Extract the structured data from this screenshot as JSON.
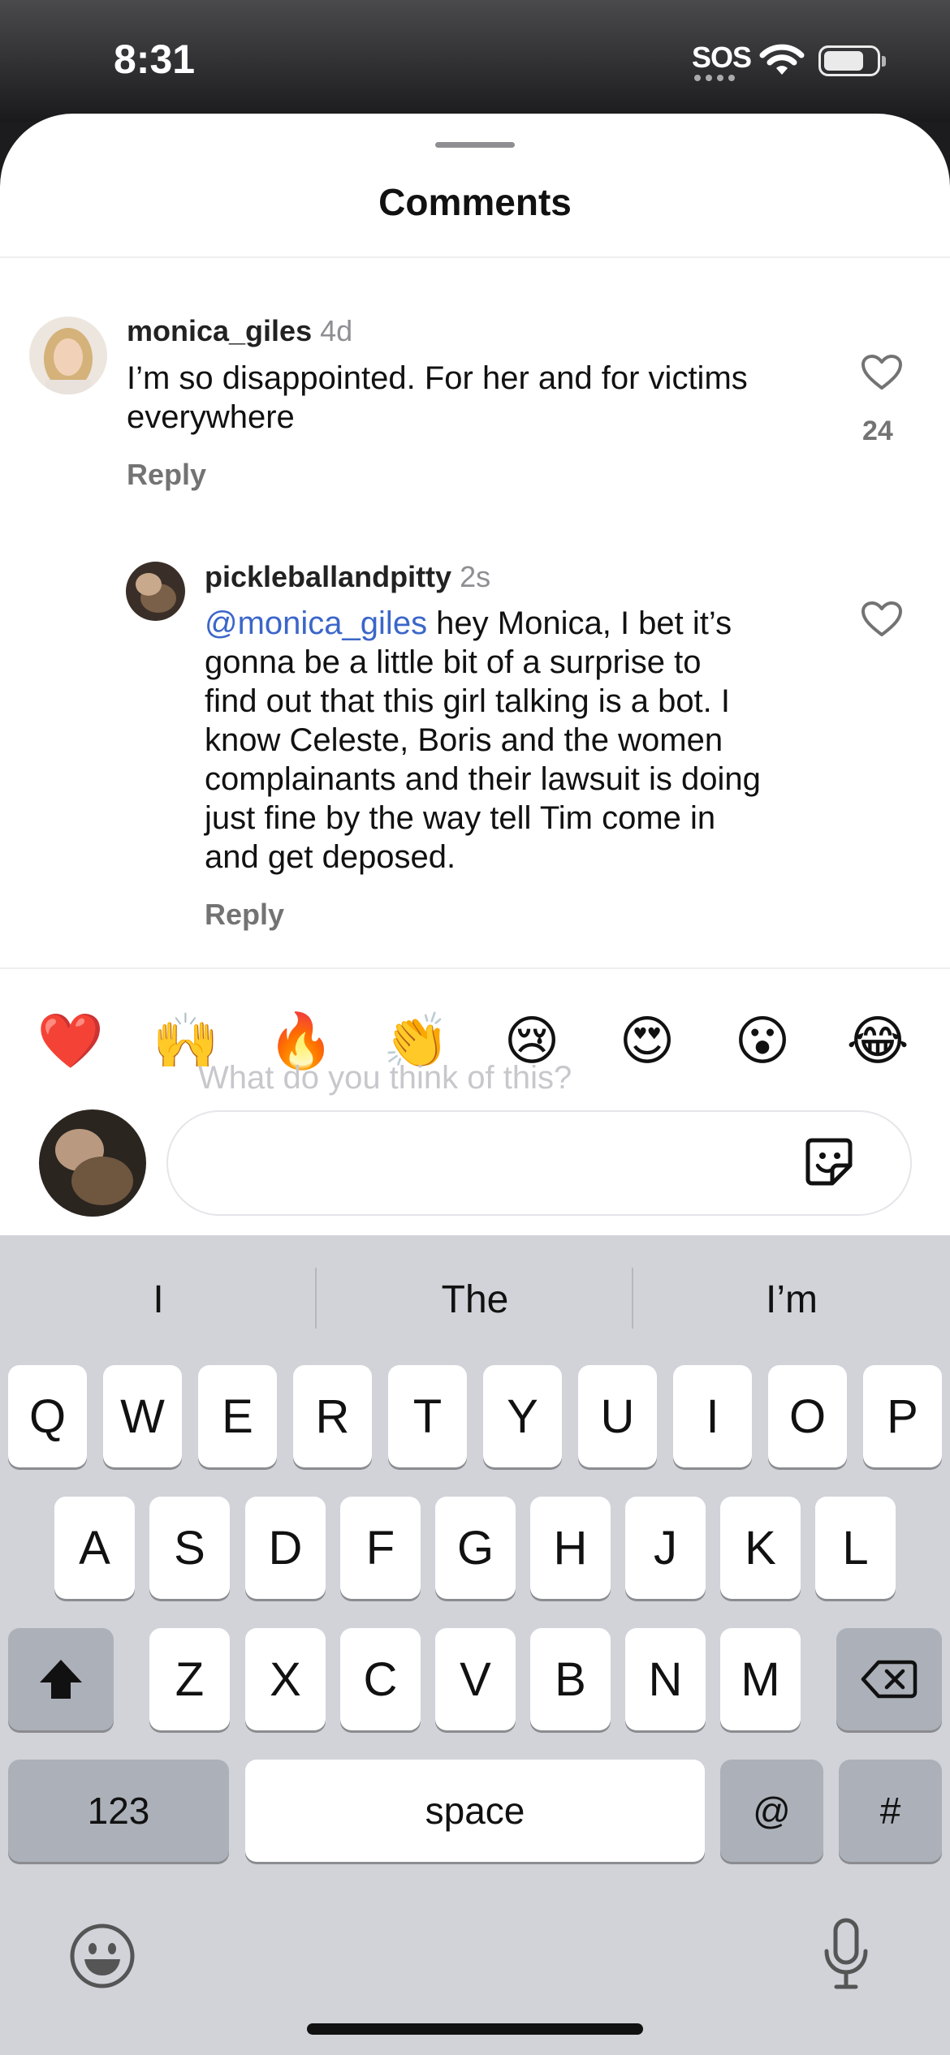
{
  "status": {
    "time": "8:31",
    "carrier": "SOS"
  },
  "sheet": {
    "title": "Comments"
  },
  "comments": [
    {
      "username": "monica_giles",
      "time": "4d",
      "lines": [
        "I’m so disappointed. For her and for victims",
        "everywhere"
      ],
      "reply_label": "Reply",
      "likes": "24"
    }
  ],
  "reply": {
    "username": "pickleballandpitty",
    "time": "2s",
    "mention": "@monica_giles",
    "lines": [
      " hey Monica, I bet it’s",
      "gonna be a little bit of a surprise to",
      "find out that this girl talking is a bot. I",
      "know Celeste, Boris and the women",
      "complainants and their lawsuit is doing",
      "just fine by the way tell Tim come in",
      "and get deposed."
    ],
    "reply_label": "Reply"
  },
  "reactions": [
    "❤️",
    "🙌",
    "🔥",
    "👏",
    "😢",
    "😍",
    "😮",
    "😂"
  ],
  "composer": {
    "placeholder": "What do you think of this?"
  },
  "keyboard": {
    "suggestions": [
      "I",
      "The",
      "I’m"
    ],
    "row1": [
      "Q",
      "W",
      "E",
      "R",
      "T",
      "Y",
      "U",
      "I",
      "O",
      "P"
    ],
    "row2": [
      "A",
      "S",
      "D",
      "F",
      "G",
      "H",
      "J",
      "K",
      "L"
    ],
    "row3": [
      "Z",
      "X",
      "C",
      "V",
      "B",
      "N",
      "M"
    ],
    "numbers_label": "123",
    "space_label": "space",
    "at_label": "@",
    "hash_label": "#"
  }
}
